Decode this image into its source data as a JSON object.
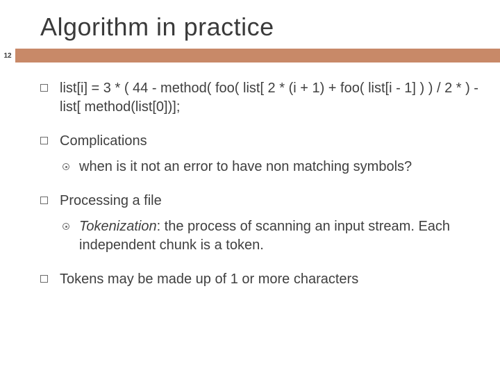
{
  "title": "Algorithm in practice",
  "page_number": "12",
  "bullets": {
    "b1": "list[i] = 3 * ( 44 - method( foo( list[ 2 * (i + 1) + foo( list[i - 1] ) ) / 2 * ) - list[ method(list[0])];",
    "b2": "Complications",
    "b2_sub1": "when is it not an error to have non matching symbols?",
    "b3": "Processing a file",
    "b3_sub1_emph": "Tokenization",
    "b3_sub1_rest": ": the process of scanning an input stream. Each independent chunk is a token.",
    "b4": "Tokens may be made up of 1 or more characters"
  }
}
